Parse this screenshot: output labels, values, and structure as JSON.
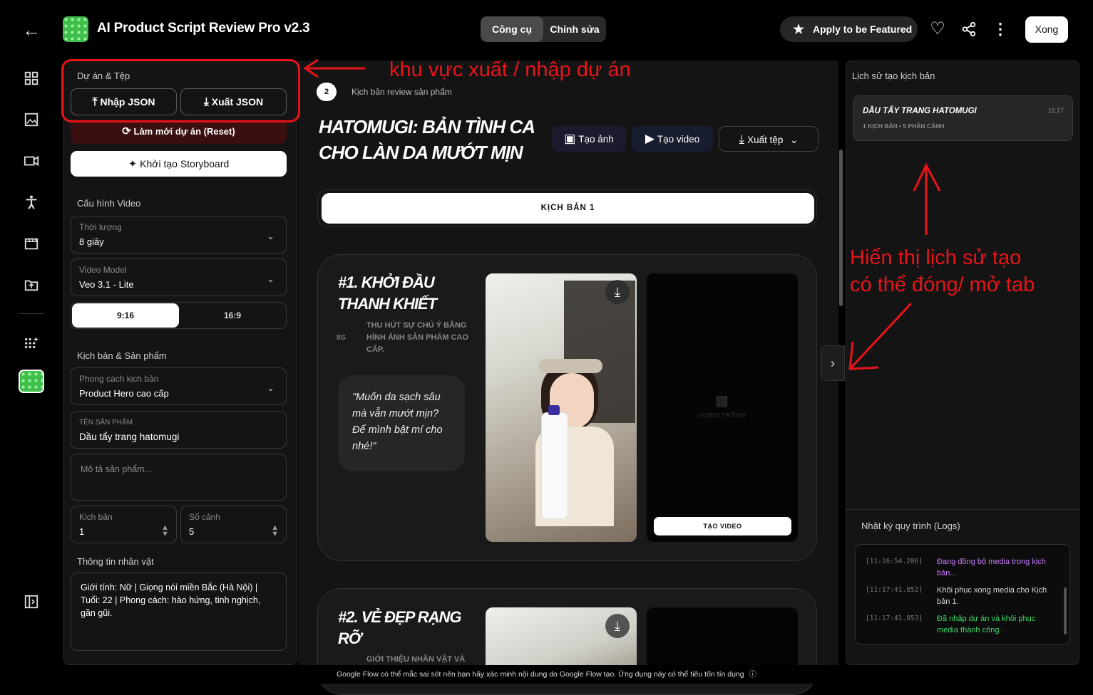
{
  "app": {
    "title": "AI Product Script Review Pro v2.3"
  },
  "header": {
    "tab_tools": "Công cụ",
    "tab_edit": "Chỉnh sửa",
    "featured": "Apply to be Featured",
    "done": "Xong"
  },
  "project": {
    "section": "Dự án & Tệp",
    "import": "Nhập JSON",
    "export": "Xuất JSON",
    "reset": "Làm mới dự án (Reset)",
    "storyboard": "Khởi tạo Storyboard"
  },
  "video_config": {
    "section": "Cấu hình Video",
    "duration_label": "Thời lượng",
    "duration_value": "8 giây",
    "model_label": "Video Model",
    "model_value": "Veo 3.1 - Lite",
    "ratio_a": "9:16",
    "ratio_b": "16:9"
  },
  "script_product": {
    "section": "Kịch bản & Sản phẩm",
    "style_label": "Phong cách kịch bản",
    "style_value": "Product Hero cao cấp",
    "name_label": "TÊN SẢN PHẨM",
    "name_value": "Dầu tẩy trang hatomugi",
    "desc_placeholder": "Mô tả sản phẩm...",
    "scripts_label": "Kịch bản",
    "scripts_value": "1",
    "scenes_label": "Số cảnh",
    "scenes_value": "5"
  },
  "character": {
    "section": "Thông tin nhân vật",
    "text": "Giới tính: Nữ | Giọng nói miền Bắc (Hà Nội) | Tuổi: 22 | Phong cách: hào hứng, tinh nghịch, gần gũi."
  },
  "annotations": {
    "a1": "khu vực xuất / nhập dự án",
    "a2_line1": "Hiển thị lịch sử tạo",
    "a2_line2": "có thể đóng/ mở tab"
  },
  "main": {
    "step": "2",
    "step_label": "Kịch bản review sản phẩm",
    "title": "HATOMUGI: BẢN TÌNH CA CHO LÀN DA MƯỚT MỊN",
    "btn_image": "Tạo ảnh",
    "btn_video": "Tạo video",
    "btn_export": "Xuất tệp",
    "tab": "KỊCH BẢN 1"
  },
  "scenes": [
    {
      "title": "#1. KHỞI ĐẦU THANH KHIẾT",
      "sec": "8S",
      "desc": "THU HÚT SỰ CHÚ Ý BẰNG HÌNH ẢNH SẢN PHẨM CAO CẤP.",
      "quote": "\"Muốn da sạch sâu mà vẫn mướt mịn? Để mình bật mí cho nhé!\"",
      "video_empty": "VIDEO TRỐNG",
      "video_btn": "TẠO VIDEO"
    },
    {
      "title": "#2. VẺ ĐẸP RẠNG RỠ",
      "desc": "GIỚI THIỆU NHÂN VẬT VÀ"
    }
  ],
  "history": {
    "section": "Lịch sử tạo kịch bản",
    "card_title": "DẦU TẨY TRANG HATOMUGI",
    "card_time": "11:17",
    "card_meta": "1 KỊCH BẢN • 5 PHÂN CẢNH"
  },
  "logs": {
    "section": "Nhật ký quy trình (Logs)",
    "entries": [
      {
        "time": "[11:16:54.206]",
        "msg": "Đang đồng bộ media trong kịch bản...",
        "color": "#c77dff"
      },
      {
        "time": "[11:17:41.852]",
        "msg": "Khôi phục xong media cho Kịch bản 1.",
        "color": "#d8d8d8"
      },
      {
        "time": "[11:17:41.853]",
        "msg": "Đã nhập dự án và khôi phục media thành công.",
        "color": "#3ddc6a"
      }
    ]
  },
  "footer": "Google Flow có thể mắc sai sót nên bạn hãy xác minh nội dung do Google Flow tạo. Ứng dụng này có thể tiêu tốn tín dụng"
}
